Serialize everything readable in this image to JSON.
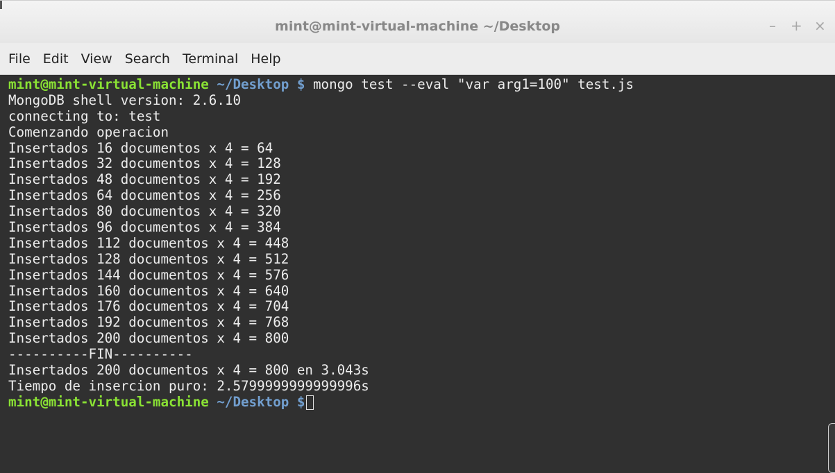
{
  "window": {
    "title": "mint@mint-virtual-machine ~/Desktop",
    "buttons": {
      "minimize": "–",
      "maximize": "+",
      "close": "×"
    }
  },
  "menu": [
    "File",
    "Edit",
    "View",
    "Search",
    "Terminal",
    "Help"
  ],
  "terminal": {
    "prompt_user": "mint@mint-virtual-machine",
    "prompt_path": " ~/Desktop $",
    "command": " mongo test --eval \"var arg1=100\" test.js",
    "output": [
      "MongoDB shell version: 2.6.10",
      "connecting to: test",
      "Comenzando operacion",
      "Insertados 16 documentos x 4 = 64",
      "Insertados 32 documentos x 4 = 128",
      "Insertados 48 documentos x 4 = 192",
      "Insertados 64 documentos x 4 = 256",
      "Insertados 80 documentos x 4 = 320",
      "Insertados 96 documentos x 4 = 384",
      "Insertados 112 documentos x 4 = 448",
      "Insertados 128 documentos x 4 = 512",
      "Insertados 144 documentos x 4 = 576",
      "Insertados 160 documentos x 4 = 640",
      "Insertados 176 documentos x 4 = 704",
      "Insertados 192 documentos x 4 = 768",
      "Insertados 200 documentos x 4 = 800",
      "----------FIN----------",
      "Insertados 200 documentos x 4 = 800 en 3.043s",
      "Tiempo de insercion puro: 2.5799999999999996s"
    ],
    "colors": {
      "background": "#303030",
      "text": "#ececec",
      "prompt_user": "#8ae234",
      "prompt_path": "#729fcf"
    }
  }
}
